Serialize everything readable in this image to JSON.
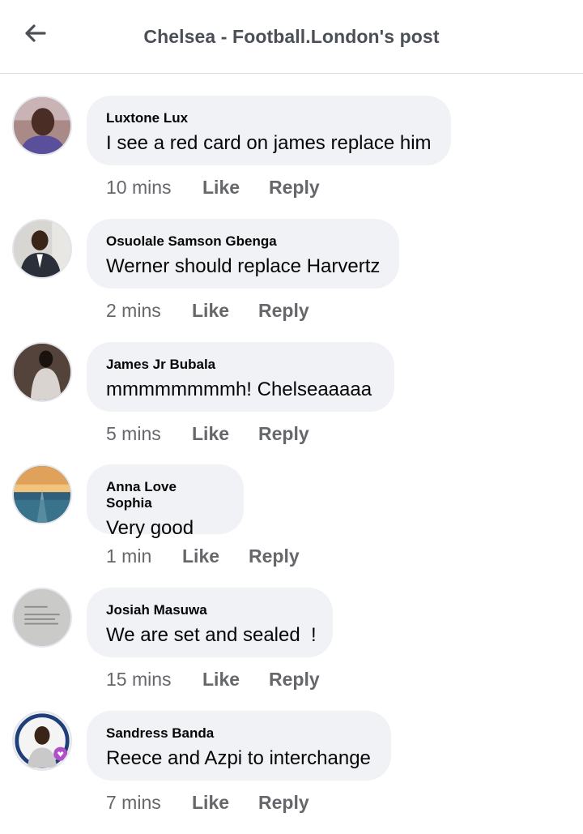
{
  "header": {
    "title": "Chelsea - Football.London's post",
    "back_icon": "arrow-left-icon"
  },
  "colors": {
    "bubble": "#f0f2f5",
    "meta_text": "#65676b",
    "title_text": "#4b4f56",
    "divider": "#dadde1"
  },
  "comments": [
    {
      "author": "Luxtone Lux",
      "text": "I see a red card on james replace him",
      "time": "10 mins",
      "like": "Like",
      "reply": "Reply"
    },
    {
      "author": "Osuolale Samson Gbenga",
      "text": "Werner should replace Harvertz",
      "time": "2 mins",
      "like": "Like",
      "reply": "Reply"
    },
    {
      "author": "James Jr Bubala",
      "text": "mmmmmmmmh! Chelseaaaaa",
      "time": "5 mins",
      "like": "Like",
      "reply": "Reply"
    },
    {
      "author": "Anna Love Sophia",
      "text": "Very good",
      "time": "1 min",
      "like": "Like",
      "reply": "Reply"
    },
    {
      "author": "Josiah Masuwa",
      "text": "We are set and sealed  !",
      "time": "15 mins",
      "like": "Like",
      "reply": "Reply"
    },
    {
      "author": "Sandress Banda",
      "text": "Reece and Azpi to interchange",
      "time": "7 mins",
      "like": "Like",
      "reply": "Reply"
    }
  ]
}
